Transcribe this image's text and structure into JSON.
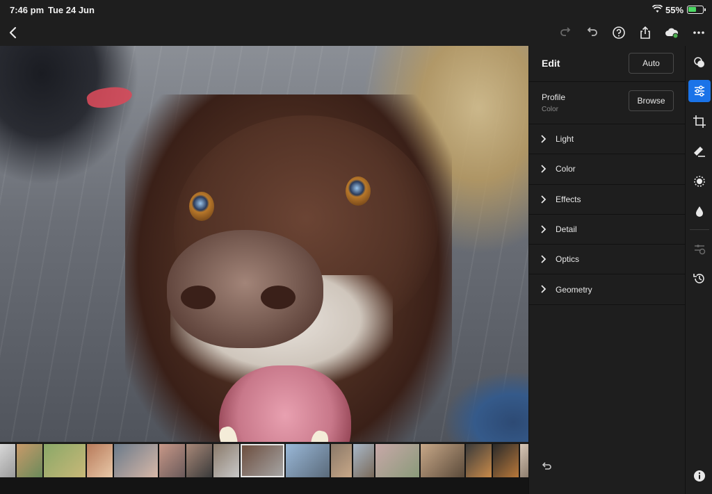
{
  "status": {
    "time": "7:46 pm",
    "date": "Tue 24 Jun",
    "battery_pct": "55%",
    "battery_level": 0.55,
    "battery_color": "#4cd964"
  },
  "toolbar": {
    "left": [
      {
        "name": "back-icon"
      }
    ],
    "right": [
      {
        "name": "redo-icon"
      },
      {
        "name": "undo-icon"
      },
      {
        "name": "help-icon"
      },
      {
        "name": "share-icon"
      },
      {
        "name": "cloud-sync-icon"
      },
      {
        "name": "more-icon"
      }
    ]
  },
  "edit_panel": {
    "title": "Edit",
    "auto_label": "Auto",
    "profile": {
      "label": "Profile",
      "value": "Color",
      "browse_label": "Browse"
    },
    "sections": [
      {
        "label": "Light"
      },
      {
        "label": "Color"
      },
      {
        "label": "Effects"
      },
      {
        "label": "Detail"
      },
      {
        "label": "Optics"
      },
      {
        "label": "Geometry"
      }
    ]
  },
  "side_tools": [
    {
      "name": "presets-icon",
      "active": false
    },
    {
      "name": "edit-sliders-icon",
      "active": true
    },
    {
      "name": "crop-icon",
      "active": false
    },
    {
      "name": "healing-icon",
      "active": false
    },
    {
      "name": "masking-icon",
      "active": false
    },
    {
      "name": "blur-icon",
      "active": false
    },
    {
      "name": "versions-icon",
      "active": false
    },
    {
      "name": "history-icon",
      "active": false
    },
    {
      "name": "info-icon",
      "active": false
    }
  ],
  "accent_color": "#1a73e8",
  "filmstrip": {
    "thumbnails": [
      {
        "colors": [
          "#d8d8d8",
          "#9a9a9a"
        ]
      },
      {
        "colors": [
          "#c89a6a",
          "#6a8a5a"
        ]
      },
      {
        "colors": [
          "#8aa868",
          "#c8b878"
        ]
      },
      {
        "colors": [
          "#b87a5a",
          "#e8c8a8"
        ]
      },
      {
        "colors": [
          "#6a7a8a",
          "#d8b8a8"
        ]
      },
      {
        "colors": [
          "#c89888",
          "#6a5a5a"
        ]
      },
      {
        "colors": [
          "#a88878",
          "#3a3a3a"
        ]
      },
      {
        "colors": [
          "#8a7a6a",
          "#c8c8c8"
        ]
      },
      {
        "colors": [
          "#6a4a3a",
          "#a8a8a8"
        ],
        "selected": true
      },
      {
        "colors": [
          "#9ab8d8",
          "#5a6a7a"
        ]
      },
      {
        "colors": [
          "#8a7868",
          "#c8a888"
        ]
      },
      {
        "colors": [
          "#a8b8c8",
          "#7a6a5a"
        ]
      },
      {
        "colors": [
          "#c8a8a8",
          "#8a9a7a"
        ]
      },
      {
        "colors": [
          "#c8a888",
          "#5a4a3a"
        ]
      },
      {
        "colors": [
          "#3a3a3a",
          "#c88a4a"
        ]
      },
      {
        "colors": [
          "#2a2a2a",
          "#b8783a"
        ]
      },
      {
        "colors": [
          "#d8c8b8",
          "#8a7a6a"
        ]
      }
    ]
  }
}
